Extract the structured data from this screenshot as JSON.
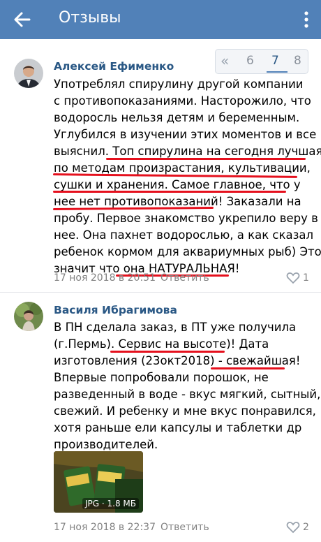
{
  "header": {
    "title": "Отзывы",
    "back_icon": "arrow-left-icon",
    "menu_icon": "kebab-menu-icon"
  },
  "pager": {
    "prev": "«",
    "pages": [
      "6",
      "7",
      "8"
    ],
    "current": "7"
  },
  "comments": [
    {
      "author": "Алексей Ефименко",
      "lines": [
        "Употреблял спирулину другой компании",
        "с противопоказаниями. Насторожило, что",
        "водоросль нельзя детям и беременным.",
        "Углубился в изучении этих моментов и все",
        "выяснил. Топ спирулина на сегодня лучшая",
        "по методам произрастания,  культивации,",
        "сушки и хранения. Самое главное, что у",
        "нее нет противопоказаний! Заказали на",
        "пробу. Первое знакомство укрепило веру в",
        "нее. Она пахнет водорослью, а как сказал",
        "ребенок кормом для аквариумных рыб) Это",
        "значит что она НАТУРАЛЬНАЯ!"
      ],
      "date": "17 ноя 2018 в 20:51",
      "reply": "Ответить",
      "likes": "1"
    },
    {
      "author": "Василя Ибрагимова",
      "lines": [
        "В ПН сделала заказ, в ПТ уже получила",
        "(г.Пермь). Сервис на высоте)! Дата",
        "изготовления (23окт2018) -  свежайшая!",
        "Впервые попробовали порошок, не",
        "разведенный в воде - вкус мягкий, сытный,",
        "свежий. И ребенку и мне вкус понравился,",
        "хотя раньше ели капсулы и таблетки др",
        "производителей."
      ],
      "attachment": "JPG · 1.8 МБ",
      "date": "17 ноя 2018 в 22:37",
      "reply": "Ответить",
      "likes": "2"
    }
  ],
  "colors": {
    "header": "#5181b8",
    "link": "#2a5885",
    "underline": "#e5101d"
  }
}
